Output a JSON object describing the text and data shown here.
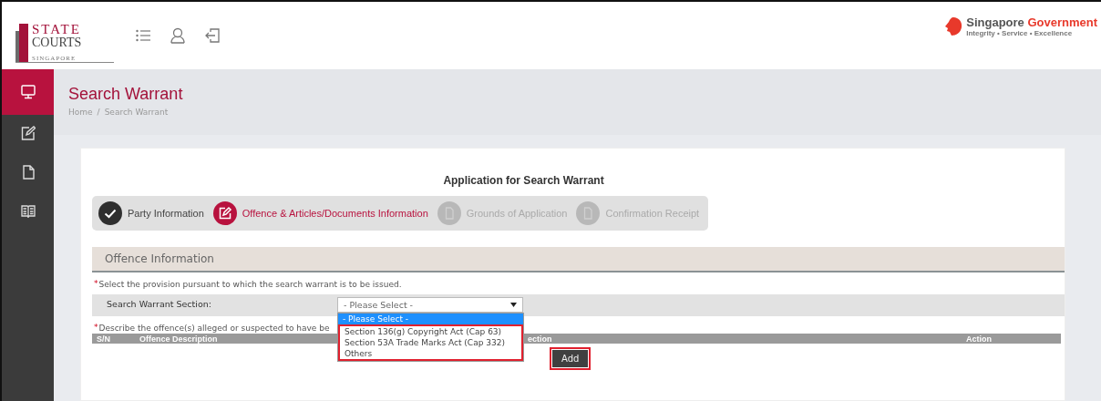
{
  "header": {
    "logo": {
      "line1": "STATE",
      "line2": "COURTS",
      "line3": "SINGAPORE"
    },
    "gov_logo": {
      "name_part1": "Singapore",
      "name_part2": "Government",
      "tagline": "Integrity • Service • Excellence"
    }
  },
  "sidebar": {
    "items": [
      {
        "selected": true
      },
      {
        "selected": false
      },
      {
        "selected": false
      },
      {
        "selected": false
      }
    ]
  },
  "page": {
    "title": "Search Warrant",
    "breadcrumb": [
      "Home",
      "Search Warrant"
    ],
    "breadcrumb_separator": "/"
  },
  "form": {
    "title": "Application for Search Warrant",
    "steps": [
      {
        "label": "Party Information",
        "kind": "done"
      },
      {
        "label": "Offence & Articles/Documents Information",
        "kind": "current"
      },
      {
        "label": "Grounds of Application",
        "kind": "pending"
      },
      {
        "label": "Confirmation Receipt",
        "kind": "pending"
      }
    ],
    "section": {
      "title": "Offence Information",
      "note1": {
        "marker": "*",
        "text": "Select the provision pursuant to which the search warrant is to be issued."
      },
      "field": {
        "label": "Search Warrant Section:",
        "value": "- Please Select -",
        "expanded": true,
        "options_highlighted": true,
        "options": [
          {
            "label": "- Please Select -",
            "selected": true
          },
          {
            "label": "Section 136(g) Copyright Act (Cap 63)",
            "selected": false
          },
          {
            "label": "Section 53A Trade Marks Act (Cap 332)",
            "selected": false
          },
          {
            "label": "Others",
            "selected": false
          }
        ]
      },
      "note2": {
        "marker": "*",
        "text": "Describe the offence(s) alleged or suspected to have be"
      },
      "table": {
        "columns": [
          "S/N",
          "Offence Description",
          "ection",
          "Action"
        ]
      },
      "add_button": {
        "label": "Add",
        "highlighted": true
      }
    }
  }
}
